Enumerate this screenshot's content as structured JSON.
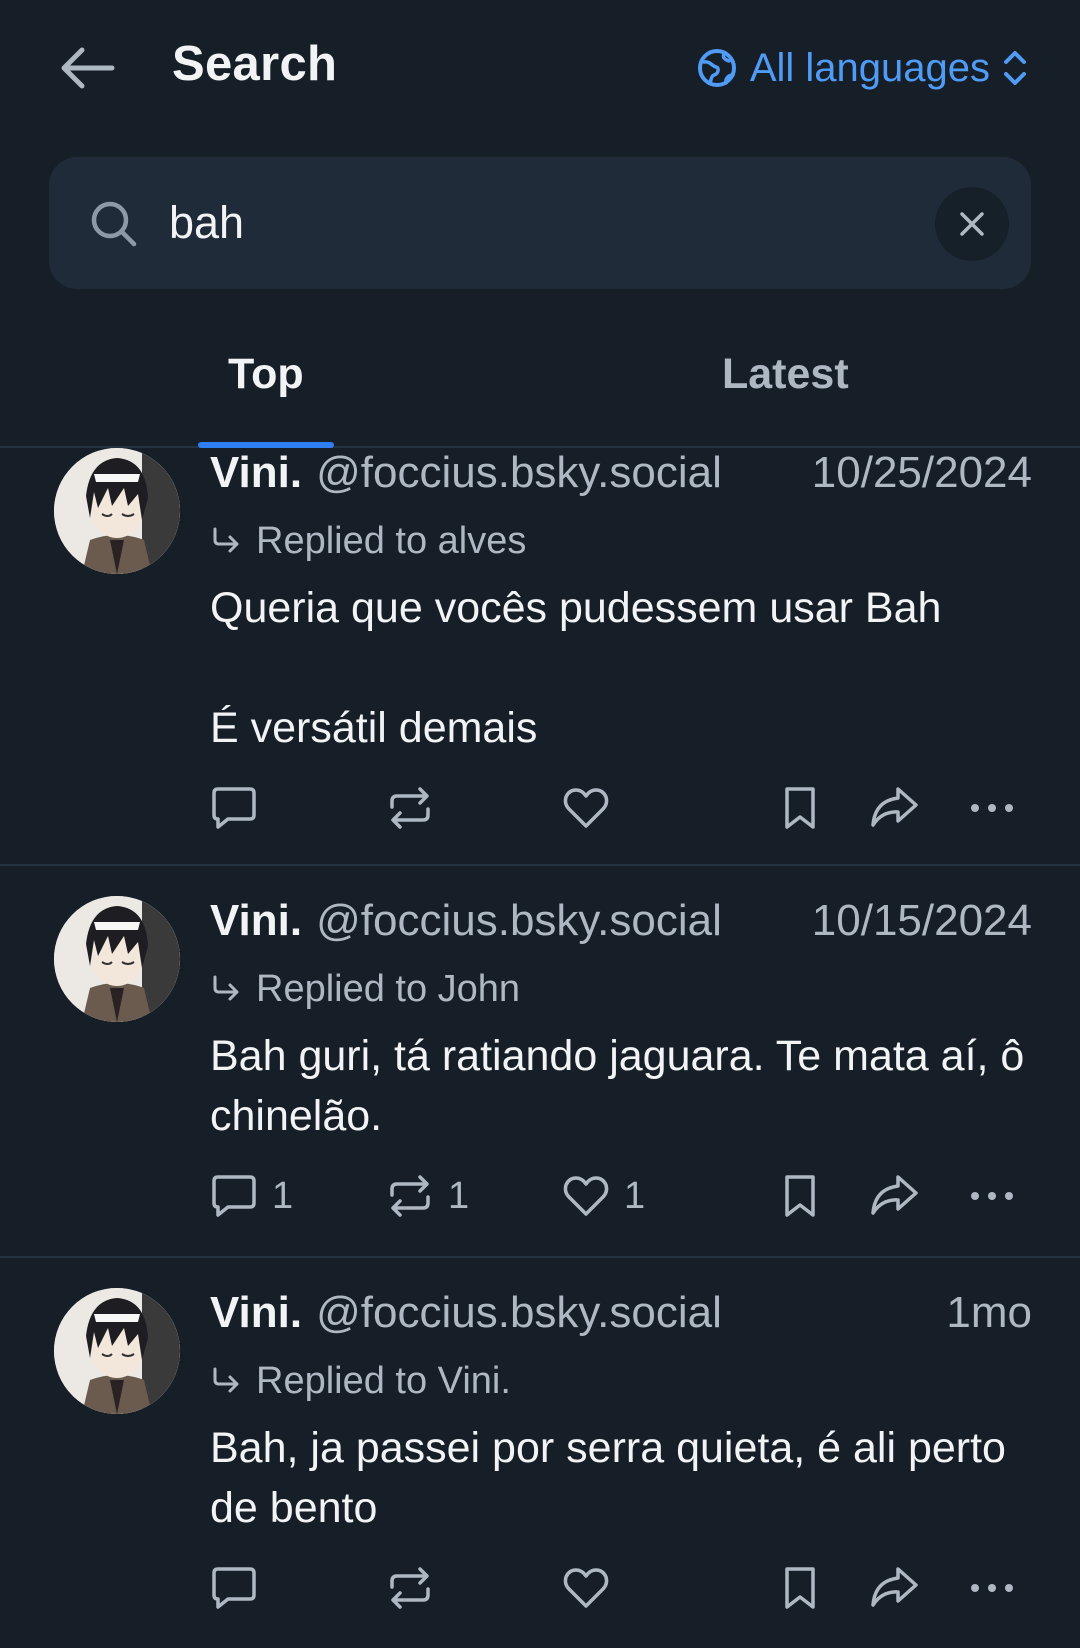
{
  "header": {
    "title": "Search",
    "language_label": "All languages"
  },
  "search": {
    "value": "bah",
    "placeholder": "Search"
  },
  "tabs": [
    {
      "label": "Top",
      "active": true
    },
    {
      "label": "Latest",
      "active": false
    }
  ],
  "posts": [
    {
      "author": "Vini.",
      "handle": "@foccius.bsky.social",
      "time": "10/25/2024",
      "reply_to": "Replied to alves",
      "text": "Queria que vocês pudessem usar Bah\n\nÉ versátil demais",
      "replies": "",
      "reposts": "",
      "likes": ""
    },
    {
      "author": "Vini.",
      "handle": "@foccius.bsky.social",
      "time": "10/15/2024",
      "reply_to": "Replied to John",
      "text": "Bah guri, tá ratiando jaguara. Te mata aí, ô chinelão.",
      "replies": "1",
      "reposts": "1",
      "likes": "1"
    },
    {
      "author": "Vini.",
      "handle": "@foccius.bsky.social",
      "time": "1mo",
      "reply_to": "Replied to Vini.",
      "text": "Bah, ja passei por serra quieta, é ali perto de bento",
      "replies": "",
      "reposts": "",
      "likes": ""
    }
  ],
  "colors": {
    "background": "#161e27",
    "accent": "#2f7ef2",
    "link": "#4f9bf5",
    "muted_text": "#aeb8c3"
  }
}
